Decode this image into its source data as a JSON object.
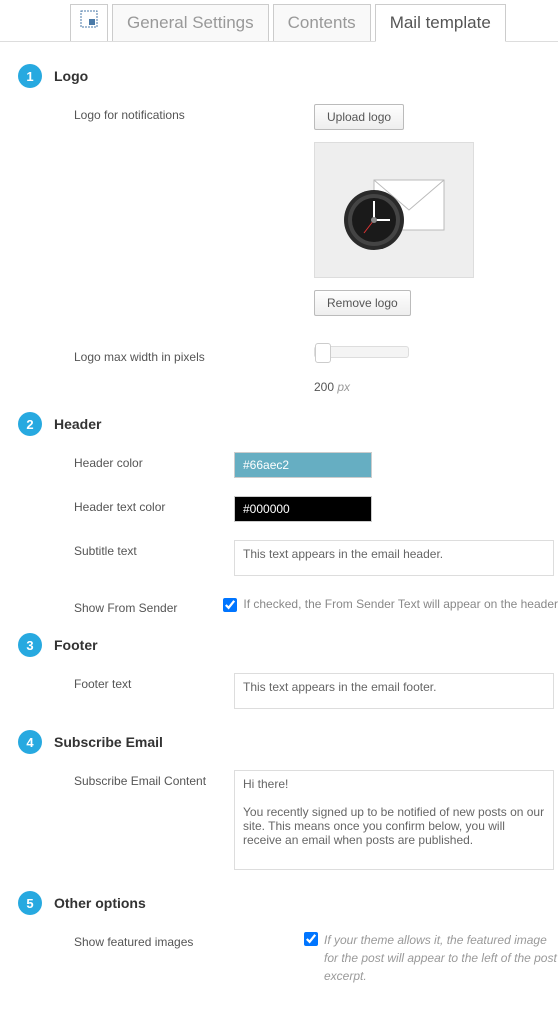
{
  "tabs": {
    "general": "General Settings",
    "contents": "Contents",
    "mail": "Mail template"
  },
  "sections": {
    "logo": {
      "num": "1",
      "title": "Logo",
      "label_notif": "Logo for notifications",
      "btn_upload": "Upload logo",
      "btn_remove": "Remove logo",
      "label_width": "Logo max width in pixels",
      "width_val": "200",
      "width_unit": "px"
    },
    "header": {
      "num": "2",
      "title": "Header",
      "label_color": "Header color",
      "color_val": "#66aec2",
      "label_text_color": "Header text color",
      "text_color_val": "#000000",
      "label_subtitle": "Subtitle text",
      "subtitle_val": "This text appears in the email header.",
      "label_from": "Show From Sender",
      "from_desc": "If checked, the From Sender Text will appear on the header"
    },
    "footer": {
      "num": "3",
      "title": "Footer",
      "label_text": "Footer text",
      "text_val": "This text appears in the email footer."
    },
    "subscribe": {
      "num": "4",
      "title": "Subscribe Email",
      "label_content": "Subscribe Email Content",
      "content_val": "Hi there!\n\nYou recently signed up to be notified of new posts on our site. This means once you confirm below, you will receive an email when posts are published."
    },
    "other": {
      "num": "5",
      "title": "Other options",
      "label_featured": "Show featured images",
      "featured_desc": "If your theme allows it, the featured image for the post will appear to the left of the post excerpt."
    }
  }
}
